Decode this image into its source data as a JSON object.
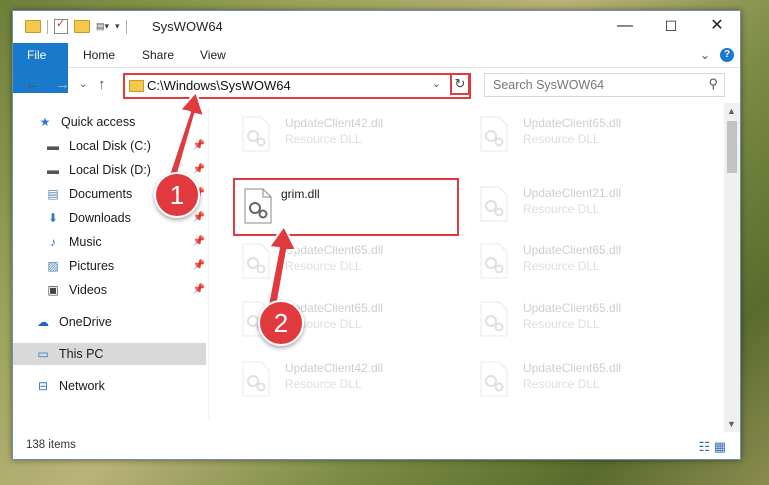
{
  "window": {
    "title": "SysWOW64",
    "controls": {
      "minimize": "—",
      "maximize": "☐",
      "close": "✕"
    }
  },
  "ribbon": {
    "tabs": [
      "File",
      "Home",
      "Share",
      "View"
    ]
  },
  "navbar": {
    "address_path": "C:\\Windows\\SysWOW64",
    "search_placeholder": "Search SysWOW64"
  },
  "sidebar": {
    "items": [
      {
        "label": "Quick access",
        "icon": "star-icon"
      },
      {
        "label": "Local Disk (C:)",
        "icon": "drive-icon",
        "pinned": true
      },
      {
        "label": "Local Disk (D:)",
        "icon": "drive-icon",
        "pinned": true
      },
      {
        "label": "Documents",
        "icon": "documents-icon",
        "pinned": true
      },
      {
        "label": "Downloads",
        "icon": "downloads-icon",
        "pinned": true
      },
      {
        "label": "Music",
        "icon": "music-icon",
        "pinned": true
      },
      {
        "label": "Pictures",
        "icon": "pictures-icon",
        "pinned": true
      },
      {
        "label": "Videos",
        "icon": "videos-icon",
        "pinned": true
      },
      {
        "label": "OneDrive",
        "icon": "cloud-icon"
      },
      {
        "label": "This PC",
        "icon": "computer-icon",
        "selected": true
      },
      {
        "label": "Network",
        "icon": "network-icon"
      }
    ]
  },
  "files": [
    {
      "name": "UpdateClient42.dll",
      "type": "Resource DLL"
    },
    {
      "name": "UpdateClient65.dll",
      "type": "Resource DLL"
    },
    {
      "name": "grim.dll",
      "type": ""
    },
    {
      "name": "UpdateClient21.dll",
      "type": "Resource DLL"
    },
    {
      "name": "UpdateClient65.dll",
      "type": "Resource DLL"
    },
    {
      "name": "UpdateClient65.dll",
      "type": "Resource DLL"
    },
    {
      "name": "UpdateClient65.dll",
      "type": "Resource DLL"
    },
    {
      "name": "UpdateClient65.dll",
      "type": "Resource DLL"
    },
    {
      "name": "UpdateClient42.dll",
      "type": "Resource DLL"
    },
    {
      "name": "UpdateClient65.dll",
      "type": "Resource DLL"
    }
  ],
  "status": {
    "item_count": "138 items"
  },
  "annotations": {
    "step1": "1",
    "step2": "2",
    "color": "#e0393e"
  },
  "colors": {
    "accent": "#1979ca",
    "highlight": "#e0393e",
    "folder": "#f2c94c"
  }
}
